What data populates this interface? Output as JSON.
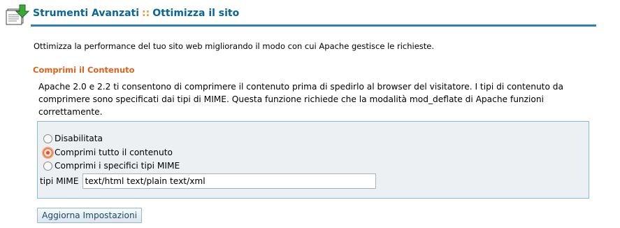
{
  "header": {
    "title_part1": "Strumenti Avanzati",
    "separator": "::",
    "title_part2": "Ottimizza il sito",
    "icon": "download-document-icon"
  },
  "intro": "Ottimizza la performance del tuo sito web migliorando il modo con cui Apache gestisce le richieste.",
  "section": {
    "title": "Comprimi il Contenuto",
    "description": "Apache 2.0 e 2.2 ti consentono di comprimere il contenuto prima di spedirlo al browser del visitatore. I tipi di contenuto da comprimere sono specificati dai tipi di MIME. Questa funzione richiede che la modalità mod_deflate di Apache funzioni correttamente."
  },
  "options": {
    "radios": [
      {
        "label": "Disabilitata",
        "checked": false
      },
      {
        "label": "Comprimi tutto il contenuto",
        "checked": true
      },
      {
        "label": "Comprimi i specifici tipi MIME",
        "checked": false
      }
    ],
    "mime_label": "tipi MIME",
    "mime_value": "text/html text/plain text/xml"
  },
  "submit_label": "Aggiorna Impostazioni",
  "colors": {
    "title_blue": "#08669c",
    "separator_orange": "#e8992b",
    "section_orange": "#e0611b",
    "rule_blue": "#2f80b9",
    "box_bg": "#ecf0f2"
  }
}
